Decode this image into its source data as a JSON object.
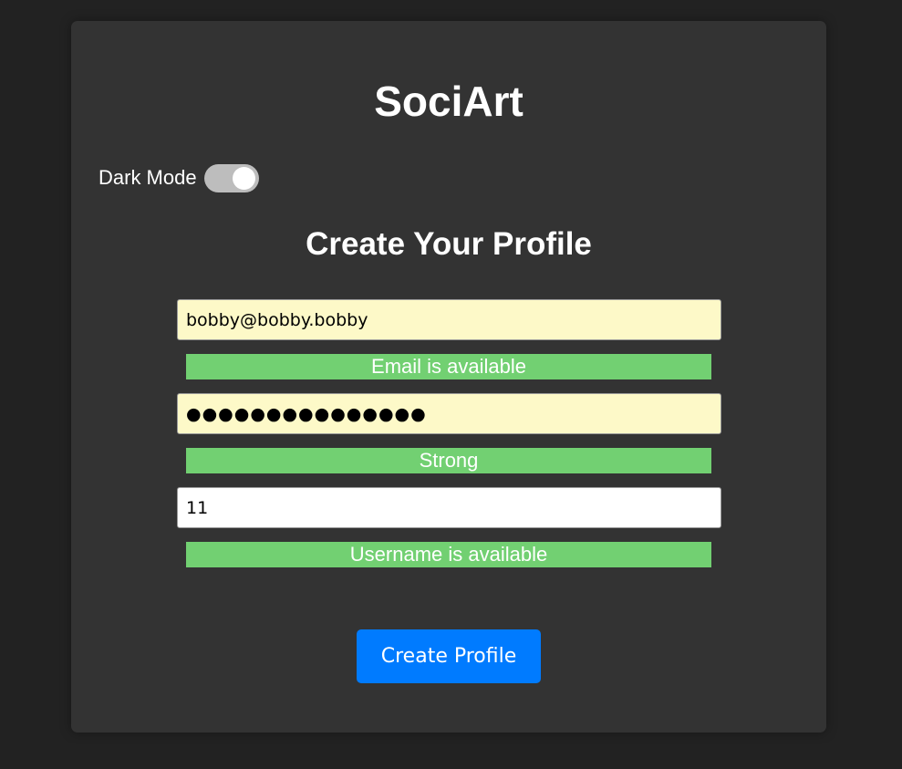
{
  "app": {
    "title": "SociArt"
  },
  "dark_mode": {
    "label": "Dark Mode",
    "enabled": true
  },
  "form": {
    "heading": "Create Your Profile",
    "email": {
      "value": "bobby@bobby.bobby",
      "status": "Email is available"
    },
    "password": {
      "masked_value": "●●●●●●●●●●●●●●●",
      "status": "Strong"
    },
    "username": {
      "value": "11",
      "status": "Username is available"
    },
    "submit_label": "Create Profile"
  },
  "colors": {
    "page_background": "#222222",
    "card_background": "#333333",
    "autofill_field": "#fdf9c8",
    "status_ok": "#72d072",
    "primary_button": "#007bff",
    "toggle_track": "#bdbdbd"
  }
}
